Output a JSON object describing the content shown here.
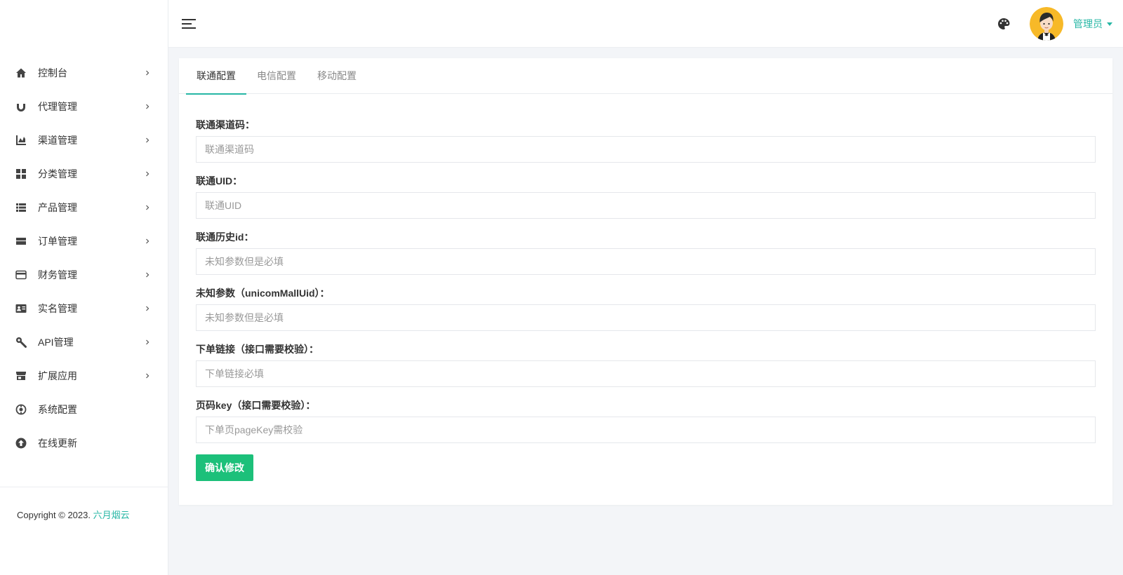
{
  "sidebar": {
    "items": [
      {
        "label": "控制台",
        "icon": "home-icon",
        "has_submenu": true
      },
      {
        "label": "代理管理",
        "icon": "magnet-icon",
        "has_submenu": true
      },
      {
        "label": "渠道管理",
        "icon": "chart-area-icon",
        "has_submenu": true
      },
      {
        "label": "分类管理",
        "icon": "grid-icon",
        "has_submenu": true
      },
      {
        "label": "产品管理",
        "icon": "list-icon",
        "has_submenu": true
      },
      {
        "label": "订单管理",
        "icon": "order-icon",
        "has_submenu": true
      },
      {
        "label": "财务管理",
        "icon": "credit-card-icon",
        "has_submenu": true
      },
      {
        "label": "实名管理",
        "icon": "id-card-icon",
        "has_submenu": true
      },
      {
        "label": "API管理",
        "icon": "wrench-icon",
        "has_submenu": true
      },
      {
        "label": "扩展应用",
        "icon": "store-icon",
        "has_submenu": true
      },
      {
        "label": "系统配置",
        "icon": "settings-icon",
        "has_submenu": false
      },
      {
        "label": "在线更新",
        "icon": "upload-icon",
        "has_submenu": false
      }
    ],
    "copyright_prefix": "Copyright © 2023.",
    "copyright_link": "六月烟云"
  },
  "header": {
    "user_name": "管理员"
  },
  "tabs": [
    {
      "label": "联通配置",
      "active": true
    },
    {
      "label": "电信配置",
      "active": false
    },
    {
      "label": "移动配置",
      "active": false
    }
  ],
  "form": {
    "fields": [
      {
        "label": "联通渠道码：",
        "placeholder": "联通渠道码",
        "value": ""
      },
      {
        "label": "联通UID：",
        "placeholder": "联通UID",
        "value": ""
      },
      {
        "label": "联通历史id：",
        "placeholder": "未知参数但是必填",
        "value": ""
      },
      {
        "label": "未知参数（unicomMallUid）：",
        "placeholder": "未知参数但是必填",
        "value": ""
      },
      {
        "label": "下单链接（接口需要校验）：",
        "placeholder": "下单链接必填",
        "value": ""
      },
      {
        "label": "页码key（接口需要校验）：",
        "placeholder": "下单页pageKey需校验",
        "value": ""
      }
    ],
    "submit_label": "确认修改"
  },
  "colors": {
    "accent": "#27b7a5",
    "submit": "#1cc07a"
  }
}
